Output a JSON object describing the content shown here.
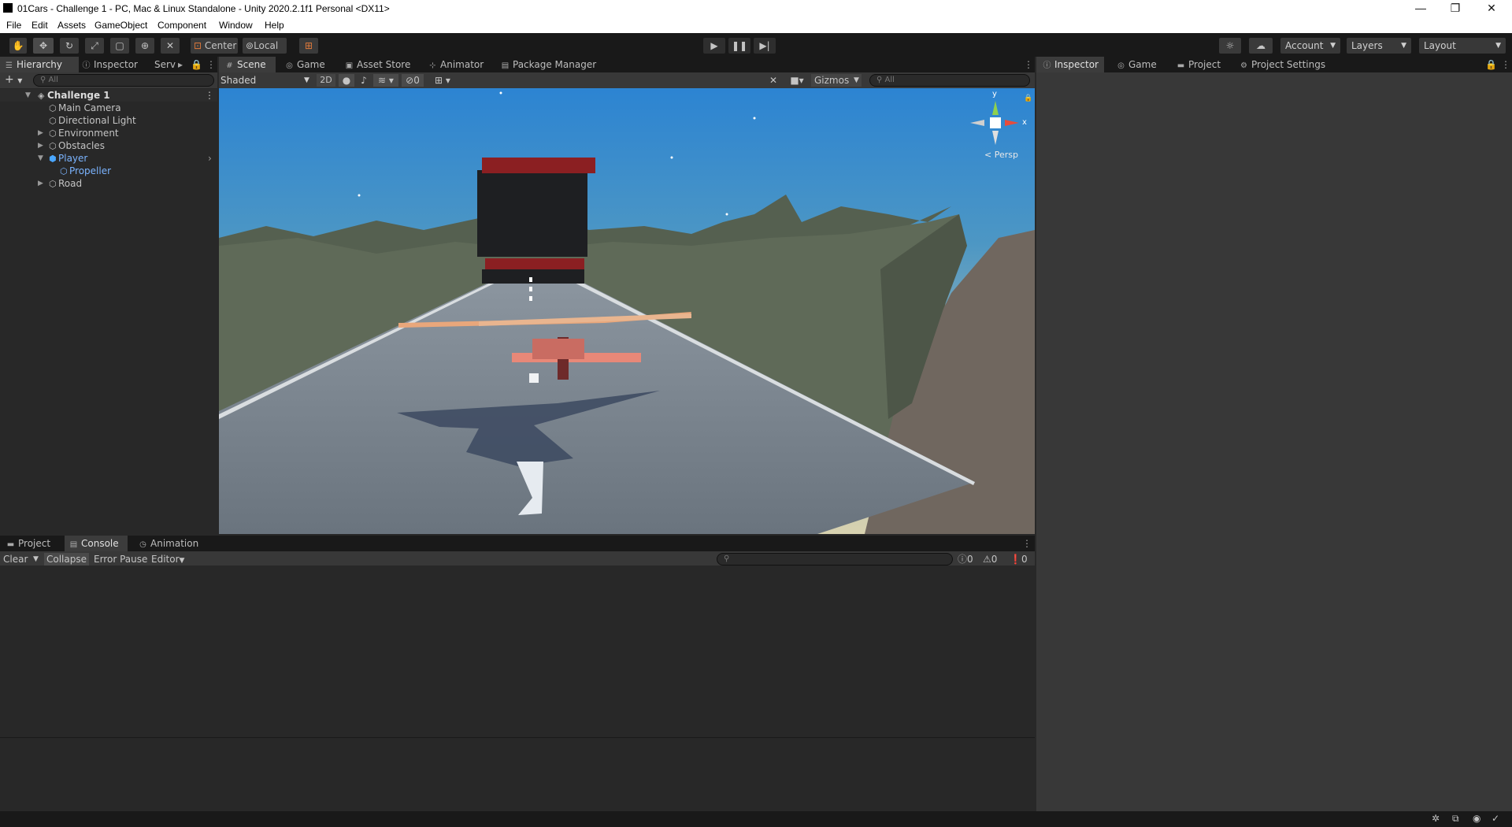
{
  "window": {
    "title": "01Cars - Challenge 1 - PC, Mac & Linux Standalone - Unity 2020.2.1f1 Personal <DX11>",
    "controls": [
      "—",
      "❐",
      "✕"
    ]
  },
  "menu": [
    "File",
    "Edit",
    "Assets",
    "GameObject",
    "Component",
    "Window",
    "Help"
  ],
  "toolbar": {
    "tools": [
      "hand-icon",
      "move-icon",
      "rotate-icon",
      "scale-icon",
      "rect-icon",
      "transform-icon",
      "custom-tool-icon"
    ],
    "pivot": "Center",
    "space": "Local",
    "account": "Account",
    "layers": "Layers",
    "layout": "Layout"
  },
  "left_tabs": [
    "Hierarchy",
    "Inspector",
    "Serv"
  ],
  "hierarchy": {
    "search_placeholder": "All",
    "rows": [
      {
        "label": "Challenge 1"
      },
      {
        "label": "Main Camera"
      },
      {
        "label": "Directional Light"
      },
      {
        "label": "Environment"
      },
      {
        "label": "Obstacles"
      },
      {
        "label": "Player"
      },
      {
        "label": "Propeller"
      },
      {
        "label": "Road"
      }
    ]
  },
  "center_tabs": [
    "Scene",
    "Game",
    "Asset Store",
    "Animator",
    "Package Manager"
  ],
  "scene_toolbar": {
    "shading": "Shaded",
    "mode2d": "2D",
    "hidden_count": "0",
    "gizmos": "Gizmos",
    "search_placeholder": "All"
  },
  "gizmo": {
    "y_label": "y",
    "x_label": "x",
    "persp_label": "< Persp"
  },
  "right_tabs": [
    "Inspector",
    "Game",
    "Project",
    "Project Settings"
  ],
  "bottom_tabs": [
    "Project",
    "Console",
    "Animation"
  ],
  "console": {
    "clear": "Clear",
    "collapse": "Collapse",
    "error_pause": "Error Pause",
    "editor": "Editor",
    "log_count": "0",
    "warn_count": "0",
    "error_count": "0"
  },
  "colors": {
    "accent_blue": "#7bb4ff",
    "panel_dark": "#191919",
    "panel_mid": "#282828",
    "panel_light": "#383838"
  }
}
